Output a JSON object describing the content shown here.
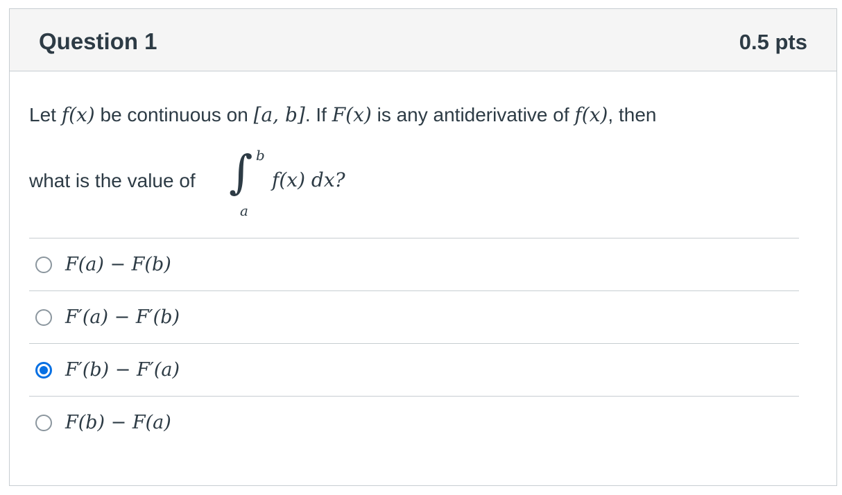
{
  "question": {
    "title": "Question 1",
    "points": "0.5 pts",
    "text_line1_a": "Let ",
    "fx": "f(x)",
    "text_line1_b": " be continuous on ",
    "interval": "[a, b]",
    "text_line1_c": ".  If ",
    "Fx": "F(x)",
    "text_line1_d": " is any antiderivative of ",
    "fx2": "f(x)",
    "text_line1_e": ", then",
    "text_line2": "what is the value of",
    "integral_upper": "b",
    "integral_lower": "a",
    "integrand": "f(x) dx?"
  },
  "answers": [
    {
      "label": "F(a) − F(b)",
      "selected": false
    },
    {
      "label": "F′(a) − F′(b)",
      "selected": false
    },
    {
      "label": "F′(b) − F′(a)",
      "selected": true
    },
    {
      "label": "F(b) − F(a)",
      "selected": false
    }
  ],
  "colors": {
    "accent": "#0770e3",
    "text": "#2d3b45",
    "border": "#c7cdd1",
    "header_bg": "#f5f5f5"
  }
}
